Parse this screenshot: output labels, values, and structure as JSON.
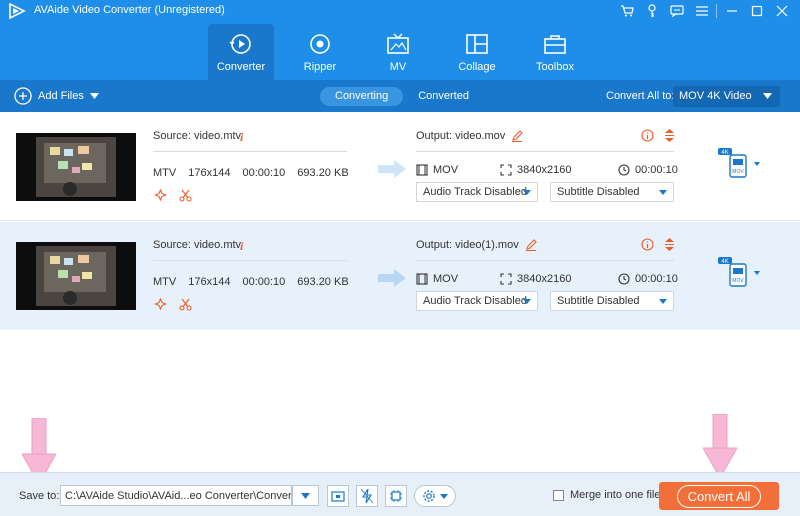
{
  "window": {
    "title": "AVAide Video Converter (Unregistered)",
    "controls": [
      "cart-icon",
      "key-icon",
      "chat-icon",
      "menu-icon",
      "minimize-icon",
      "maximize-icon",
      "close-icon"
    ]
  },
  "nav": {
    "tabs": [
      {
        "label": "Converter",
        "icon": "converter-icon",
        "active": true
      },
      {
        "label": "Ripper",
        "icon": "disc-icon",
        "active": false
      },
      {
        "label": "MV",
        "icon": "tv-icon",
        "active": false
      },
      {
        "label": "Collage",
        "icon": "collage-icon",
        "active": false
      },
      {
        "label": "Toolbox",
        "icon": "toolbox-icon",
        "active": false
      }
    ]
  },
  "toolbar": {
    "add_files_label": "Add Files",
    "segments": [
      {
        "label": "Converting",
        "active": true
      },
      {
        "label": "Converted",
        "active": false
      }
    ],
    "convert_all_to_label": "Convert All to:",
    "format_value": "MOV 4K Video"
  },
  "files": [
    {
      "source": "Source: video.mtv",
      "format": "MTV",
      "resolution": "176x144",
      "duration": "00:00:10",
      "size": "693.20 KB",
      "output": "Output: video.mov",
      "out_format": "MOV",
      "out_resolution": "3840x2160",
      "out_duration": "00:00:10",
      "audio_track": "Audio Track Disabled",
      "subtitle": "Subtitle Disabled",
      "badge_top": "4K",
      "badge_bottom": "MOV"
    },
    {
      "source": "Source: video.mtv",
      "format": "MTV",
      "resolution": "176x144",
      "duration": "00:00:10",
      "size": "693.20 KB",
      "output": "Output: video(1).mov",
      "out_format": "MOV",
      "out_resolution": "3840x2160",
      "out_duration": "00:00:10",
      "audio_track": "Audio Track Disabled",
      "subtitle": "Subtitle Disabled",
      "badge_top": "4K",
      "badge_bottom": "MOV"
    }
  ],
  "footer": {
    "save_to_label": "Save to:",
    "save_path": "C:\\AVAide Studio\\AVAid...eo Converter\\Converted",
    "merge_label": "Merge into one file",
    "merge_checked": false,
    "convert_all_label": "Convert All"
  },
  "colors": {
    "header": "#1e8ee8",
    "toolbar": "#1a78cc",
    "row_alt": "#e7f1fb",
    "accent_orange": "#f26f3a",
    "annotation_pink": "#f7b8d6"
  }
}
